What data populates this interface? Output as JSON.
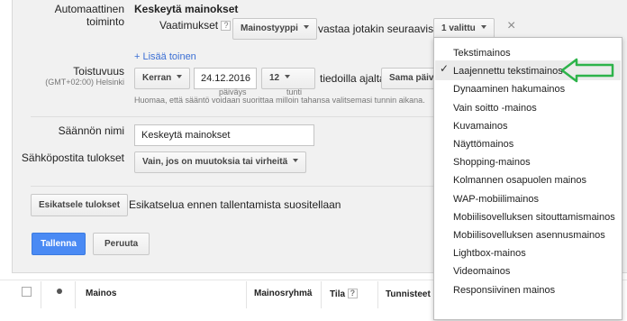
{
  "rule": {
    "auto_action_label": "Automaattinen toiminto",
    "action_value": "Keskeytä mainokset",
    "requirements_label": "Vaatimukset",
    "help": "?",
    "ad_type_dropdown": "Mainostyyppi",
    "matches_text": "vastaa jotakin seuraavista",
    "selected_count": "1 valittu",
    "close": "×",
    "add_another": "+ Lisää toinen"
  },
  "frequency": {
    "label": "Toistuvuus",
    "timezone": "(GMT+02:00) Helsinki",
    "frequency_dropdown": "Kerran",
    "date": "24.12.2016",
    "date_sub": "päiväys",
    "hour": "12",
    "hour_sub": "tunti",
    "data_text": "tiedoilla ajalta",
    "same_day": "Sama päivä",
    "note": "Huomaa, että sääntö voidaan suorittaa milloin tahansa valitsemasi tunnin aikana."
  },
  "name": {
    "label": "Säännön nimi",
    "value": "Keskeytä mainokset"
  },
  "email": {
    "label": "Sähköpostita tulokset",
    "dropdown": "Vain, jos on muutoksia tai virheitä"
  },
  "preview": {
    "button": "Esikatsele tulokset",
    "text": "Esikatselua ennen tallentamista suositellaan"
  },
  "actions": {
    "save": "Tallenna",
    "cancel": "Peruuta"
  },
  "table": {
    "columns": [
      "Mainos",
      "Mainosryhmä",
      "Tila",
      "Tunnisteet"
    ]
  },
  "menu": {
    "items": [
      "Tekstimainos",
      "Laajennettu tekstimainos",
      "Dynaaminen hakumainos",
      "Vain soitto -mainos",
      "Kuvamainos",
      "Näyttömainos",
      "Shopping-mainos",
      "Kolmannen osapuolen mainos",
      "WAP-mobiilimainos",
      "Mobiilisovelluksen sitouttamismainos",
      "Mobiilisovelluksen asennusmainos",
      "Lightbox-mainos",
      "Videomainos",
      "Responsiivinen mainos"
    ],
    "selected_index": 1,
    "check": "✓"
  },
  "colors": {
    "accent": "#4a8af4",
    "arrow": "#2db34a",
    "link": "#3b6fd4"
  }
}
